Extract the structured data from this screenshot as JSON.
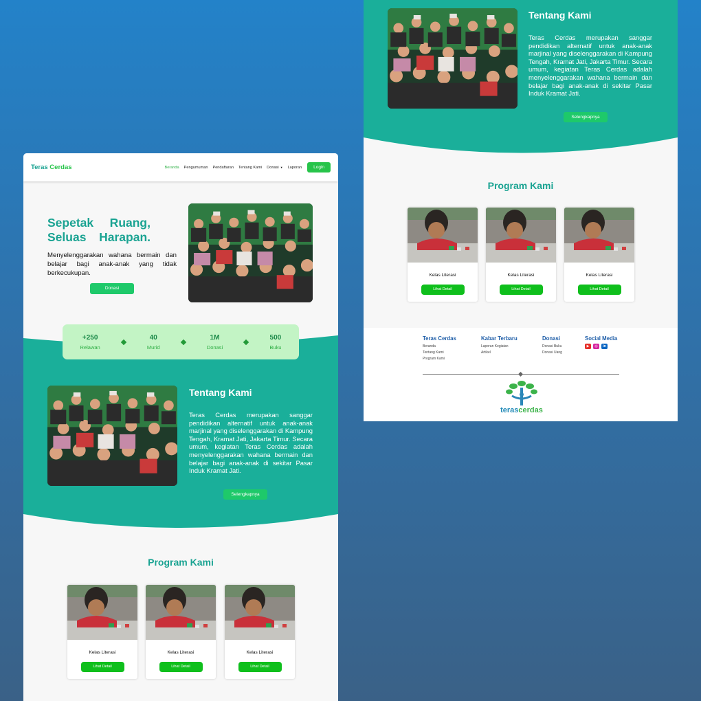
{
  "nav": {
    "brand_part1": "Teras",
    "brand_part2": "Cerdas",
    "items": [
      {
        "label": "Beranda",
        "active": true
      },
      {
        "label": "Pengumuman"
      },
      {
        "label": "Pendaftaran"
      },
      {
        "label": "Tentang Kami"
      },
      {
        "label": "Donasi",
        "dropdown": true
      },
      {
        "label": "Laporan"
      }
    ],
    "login_label": "Login"
  },
  "hero": {
    "title_line1": "Sepetak Ruang,",
    "title_line2": "Seluas Harapan.",
    "subtitle": "Menyelenggarakan wahana bermain dan belajar bagi anak-anak yang tidak berkecukupan.",
    "button_label": "Donasi"
  },
  "stats": [
    {
      "value": "+250",
      "label": "Relawan"
    },
    {
      "value": "40",
      "label": "Murid"
    },
    {
      "value": "1M",
      "label": "Donasi"
    },
    {
      "value": "500",
      "label": "Buku"
    }
  ],
  "about": {
    "title": "Tentang Kami",
    "text": "Teras Cerdas merupakan sanggar pendidikan alternatif untuk anak-anak marjinal yang diselenggarakan di Kampung Tengah, Kramat Jati, Jakarta Timur. Secara umum, kegiatan Teras Cerdas adalah menyelenggarakan wahana bermain dan belajar bagi anak-anak di sekitar Pasar Induk Kramat Jati.",
    "button_label": "Selengkapnya"
  },
  "program": {
    "title": "Program Kami",
    "cards": [
      {
        "title": "Kelas Literasi",
        "button": "Lihat Detail"
      },
      {
        "title": "Kelas Literasi",
        "button": "Lihat Detail"
      },
      {
        "title": "Kelas Literasi",
        "button": "Lihat Detail"
      }
    ]
  },
  "footer": {
    "col1": {
      "heading": "Teras Cerdas",
      "links": [
        "Beranda",
        "Tentang Kami",
        "Program Kami"
      ]
    },
    "col2": {
      "heading": "Kabar Terbaru",
      "links": [
        "Laporan Kegiatan",
        "Artikel"
      ]
    },
    "col3": {
      "heading": "Donasi",
      "links": [
        "Donasi Buku",
        "Donasi Uang"
      ]
    },
    "col4": {
      "heading": "Social Media",
      "icons": [
        "youtube-icon",
        "instagram-icon",
        "linkedin-icon"
      ]
    },
    "logo_part1": "teras",
    "logo_part2": "cerdas"
  },
  "colors": {
    "teal": "#1aaf9a",
    "green": "#27c44a",
    "stats_bg": "#c3f4c5",
    "link_blue": "#1f5ea8"
  }
}
